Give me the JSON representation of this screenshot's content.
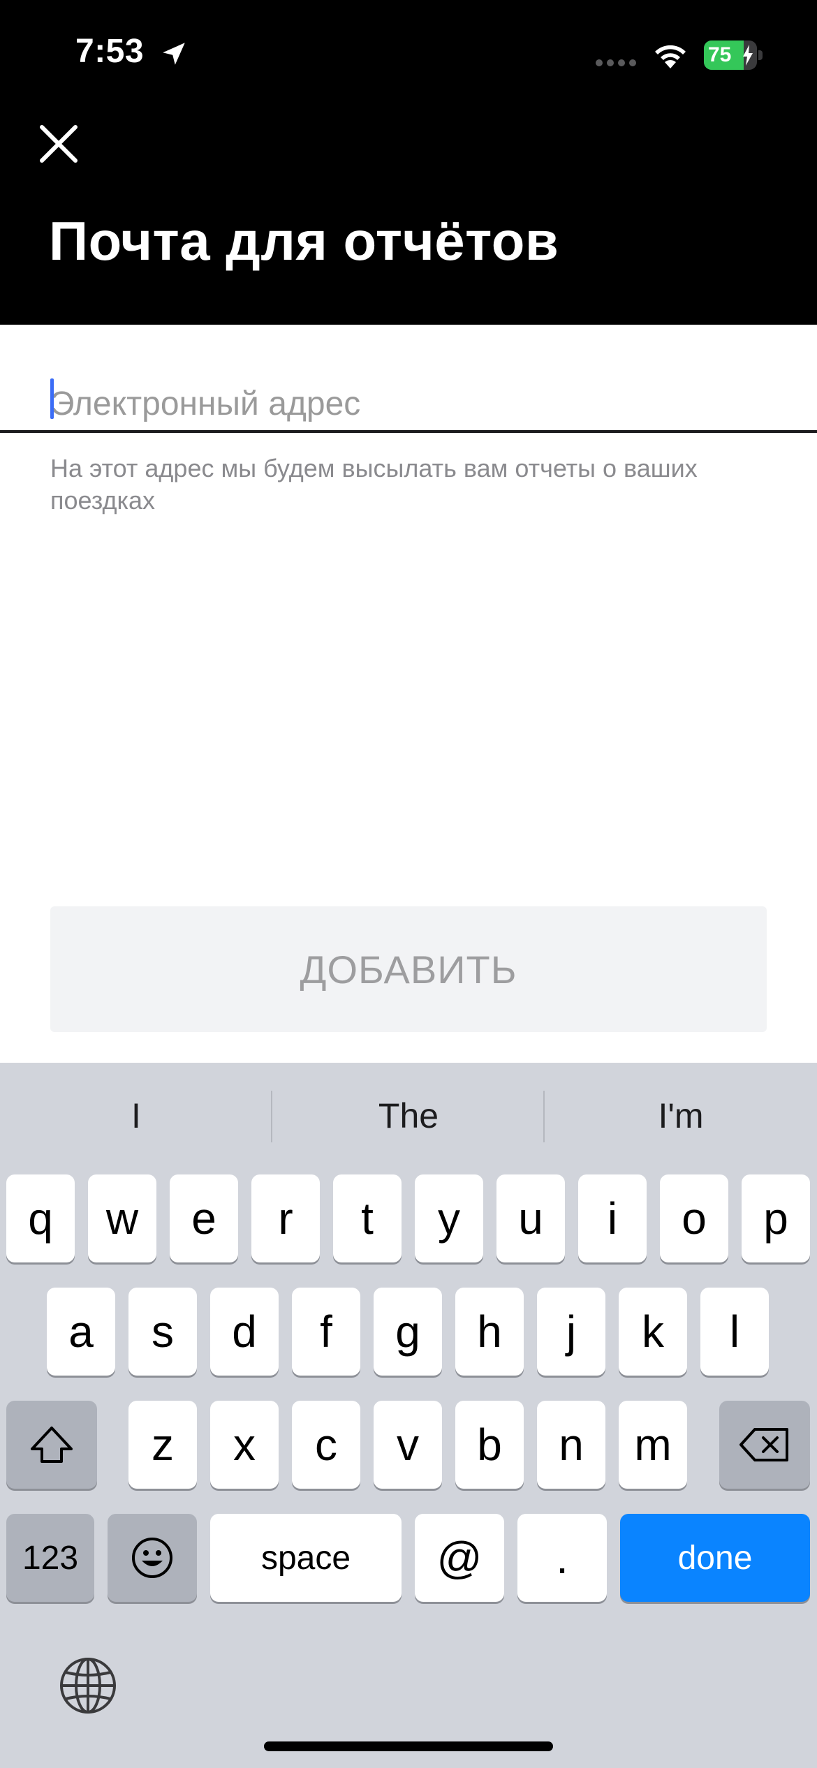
{
  "status_bar": {
    "time": "7:53",
    "battery_percent": "75",
    "battery_level": 0.75,
    "battery_color": "#34c759",
    "icons": [
      "location-arrow-icon",
      "cellular-signal-icon",
      "wifi-icon",
      "battery-charging-icon"
    ]
  },
  "header": {
    "title": "Почта для отчётов",
    "close_icon": "close-icon",
    "background": "#000000"
  },
  "form": {
    "email_placeholder": "Электронный адрес",
    "email_value": "",
    "helper_text": "На этот адрес мы будем высылать вам отчеты о ваших поездках",
    "add_button_label": "ДОБАВИТЬ",
    "caret_color": "#3b6cf6"
  },
  "keyboard": {
    "suggestions": [
      "I",
      "The",
      "I'm"
    ],
    "row1": [
      "q",
      "w",
      "e",
      "r",
      "t",
      "y",
      "u",
      "i",
      "o",
      "p"
    ],
    "row2": [
      "a",
      "s",
      "d",
      "f",
      "g",
      "h",
      "j",
      "k",
      "l"
    ],
    "row3": [
      "z",
      "x",
      "c",
      "v",
      "b",
      "n",
      "m"
    ],
    "bottom": {
      "numbers": "123",
      "space": "space",
      "at": "@",
      "dot": ".",
      "done": "done"
    },
    "icons": [
      "shift-icon",
      "backspace-icon",
      "emoji-icon",
      "globe-icon"
    ],
    "done_color": "#0a84ff"
  }
}
